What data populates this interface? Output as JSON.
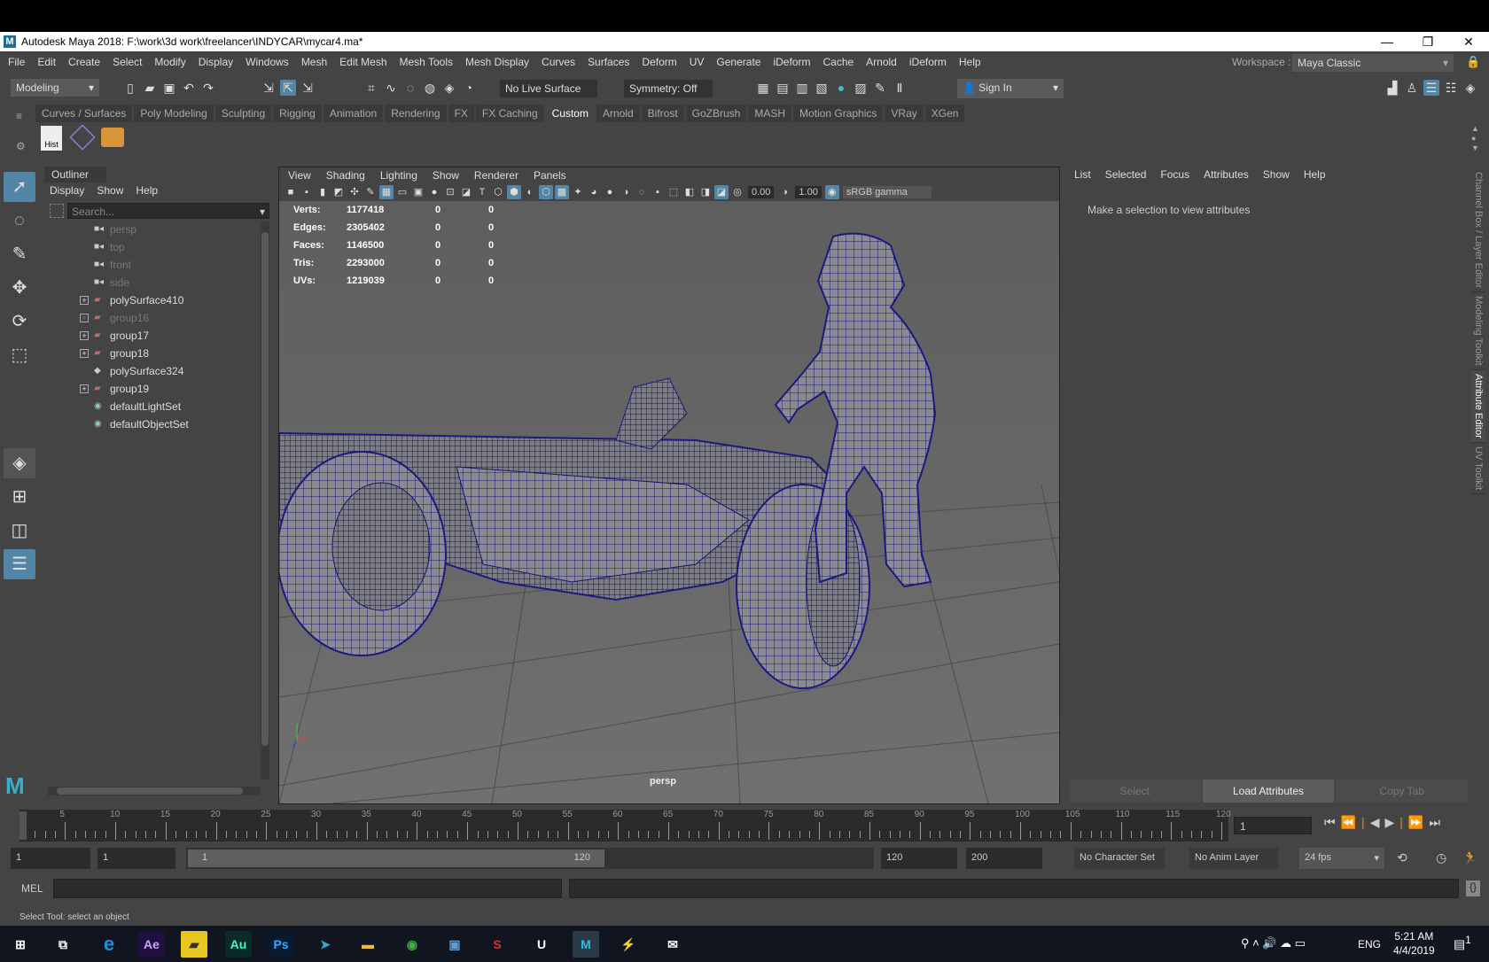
{
  "window": {
    "title": "Autodesk Maya 2018: F:\\work\\3d work\\freelancer\\INDYCAR\\mycar4.ma*",
    "logo": "M",
    "minimize": "—",
    "restore": "❐",
    "close": "✕"
  },
  "menu": [
    "File",
    "Edit",
    "Create",
    "Select",
    "Modify",
    "Display",
    "Windows",
    "Mesh",
    "Edit Mesh",
    "Mesh Tools",
    "Mesh Display",
    "Curves",
    "Surfaces",
    "Deform",
    "UV",
    "Generate",
    "iDeform",
    "Cache",
    "Arnold",
    "iDeform",
    "Help"
  ],
  "workspace": {
    "label": "Workspace :",
    "value": "Maya Classic"
  },
  "toolbar": {
    "mode": "Modeling",
    "live_surface": "No Live Surface",
    "symmetry": "Symmetry: Off",
    "sign_in": "Sign In"
  },
  "shelf": {
    "tabs": [
      "Curves / Surfaces",
      "Poly Modeling",
      "Sculpting",
      "Rigging",
      "Animation",
      "Rendering",
      "FX",
      "FX Caching",
      "Custom",
      "Arnold",
      "Bifrost",
      "GoZBrush",
      "MASH",
      "Motion Graphics",
      "VRay",
      "XGen"
    ],
    "active": "Custom",
    "hist_label": "Hist"
  },
  "outliner": {
    "title": "Outliner",
    "menu": [
      "Display",
      "Show",
      "Help"
    ],
    "search_placeholder": "Search...",
    "items": [
      {
        "label": "persp",
        "type": "camera",
        "dim": true,
        "expandable": false
      },
      {
        "label": "top",
        "type": "camera",
        "dim": true,
        "expandable": false
      },
      {
        "label": "front",
        "type": "camera",
        "dim": true,
        "expandable": false
      },
      {
        "label": "side",
        "type": "camera",
        "dim": true,
        "expandable": false
      },
      {
        "label": "polySurface410",
        "type": "group",
        "dim": false,
        "expandable": true
      },
      {
        "label": "group16",
        "type": "group",
        "dim": true,
        "expandable": true
      },
      {
        "label": "group17",
        "type": "group",
        "dim": false,
        "expandable": true
      },
      {
        "label": "group18",
        "type": "group",
        "dim": false,
        "expandable": true
      },
      {
        "label": "polySurface324",
        "type": "mesh",
        "dim": false,
        "expandable": false
      },
      {
        "label": "group19",
        "type": "group",
        "dim": false,
        "expandable": true
      },
      {
        "label": "defaultLightSet",
        "type": "set",
        "dim": false,
        "expandable": false
      },
      {
        "label": "defaultObjectSet",
        "type": "set",
        "dim": false,
        "expandable": false
      }
    ]
  },
  "viewport": {
    "menu": [
      "View",
      "Shading",
      "Lighting",
      "Show",
      "Renderer",
      "Panels"
    ],
    "exposure": "0.00",
    "gamma": "1.00",
    "colorspace": "sRGB gamma",
    "camera": "persp",
    "stats": [
      [
        "Verts:",
        "1177418",
        "0",
        "0"
      ],
      [
        "Edges:",
        "2305402",
        "0",
        "0"
      ],
      [
        "Faces:",
        "1146500",
        "0",
        "0"
      ],
      [
        "Tris:",
        "2293000",
        "0",
        "0"
      ],
      [
        "UVs:",
        "1219039",
        "0",
        "0"
      ]
    ]
  },
  "attribute_editor": {
    "menu": [
      "List",
      "Selected",
      "Focus",
      "Attributes",
      "Show",
      "Help"
    ],
    "message": "Make a selection to view attributes",
    "buttons": [
      "Select",
      "Load Attributes",
      "Copy Tab"
    ]
  },
  "side_tabs": [
    "Channel Box / Layer Editor",
    "Modeling Toolkit",
    "Attribute Editor",
    "UV Toolkit"
  ],
  "timeline": {
    "start": 1,
    "end": 120,
    "current_frame": "1",
    "labels": [
      5,
      10,
      15,
      20,
      25,
      30,
      35,
      40,
      45,
      50,
      55,
      60,
      65,
      70,
      75,
      80,
      85,
      90,
      95,
      100,
      105,
      110,
      115,
      120
    ]
  },
  "range": {
    "start": "1",
    "playback_start": "1",
    "slider_start": "1",
    "slider_end": "120",
    "playback_end": "120",
    "end": "200",
    "character_set": "No Character Set",
    "anim_layer": "No Anim Layer",
    "fps": "24 fps"
  },
  "command_line": {
    "label": "MEL"
  },
  "status_line": "Select Tool: select an object",
  "taskbar": {
    "language": "ENG",
    "time": "5:21 AM",
    "date": "4/4/2019",
    "apps": [
      "Ae",
      "Au",
      "Ps",
      "M"
    ],
    "notification_count": "1"
  }
}
